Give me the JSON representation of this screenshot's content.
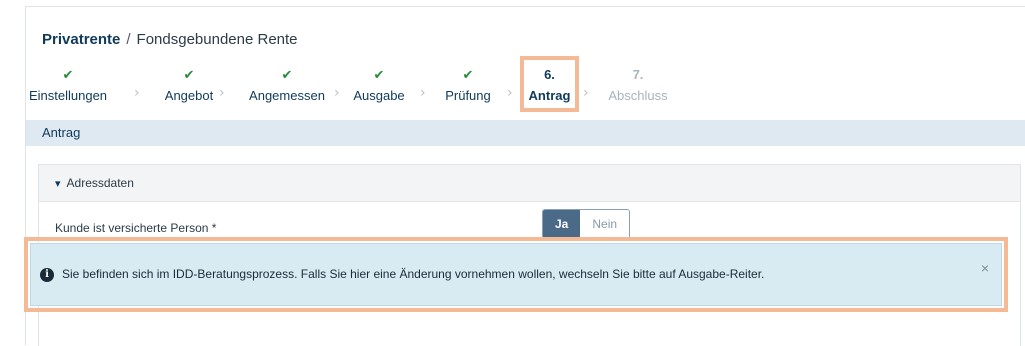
{
  "breadcrumb": {
    "root": "Privatrente",
    "separator": "/",
    "current": "Fondsgebundene Rente"
  },
  "stepper": {
    "steps": [
      {
        "label": "Einstellungen",
        "state": "done",
        "marker": "✔"
      },
      {
        "label": "Angebot",
        "state": "done",
        "marker": "✔"
      },
      {
        "label": "Angemessen",
        "state": "done",
        "marker": "✔"
      },
      {
        "label": "Ausgabe",
        "state": "done",
        "marker": "✔"
      },
      {
        "label": "Prüfung",
        "state": "done",
        "marker": "✔"
      },
      {
        "label": "Antrag",
        "state": "active",
        "marker": "6."
      },
      {
        "label": "Abschluss",
        "state": "disabled",
        "marker": "7."
      }
    ],
    "chevron": "›"
  },
  "section": {
    "title": "Antrag"
  },
  "panel": {
    "title": "Adressdaten",
    "chevron": "▾",
    "field_label": "Kunde ist versicherte Person *",
    "toggle": {
      "options": [
        "Ja",
        "Nein"
      ],
      "selected": "Ja"
    }
  },
  "info": {
    "icon": "i",
    "message": "Sie befinden sich im IDD-Beratungsprozess. Falls Sie hier eine Änderung vornehmen wollen, wechseln Sie bitte auf Ausgabe-Reiter.",
    "close": "×"
  },
  "colors": {
    "highlight": "#f4b995",
    "done": "#2a8a3a",
    "section_bg": "#dfe9f1",
    "info_bg": "#d8ebf2",
    "toggle_on": "#4a6a88"
  }
}
